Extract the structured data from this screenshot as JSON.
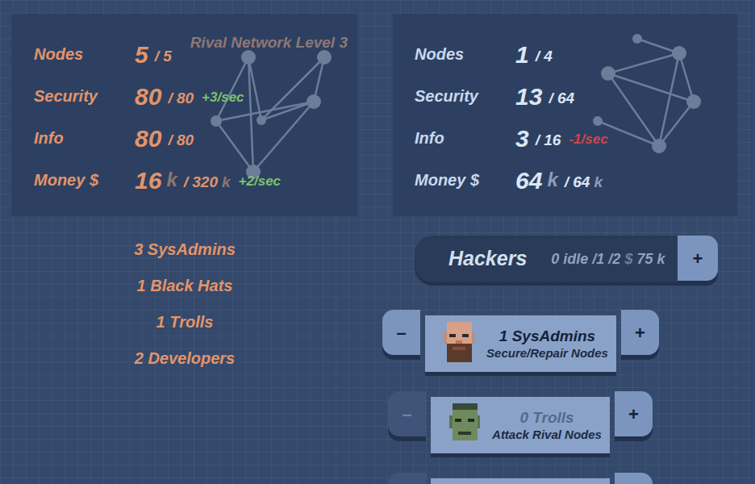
{
  "rival": {
    "title": "Rival Network Level 3",
    "stats": [
      {
        "label": "Nodes",
        "value": "5",
        "value_unit": "",
        "max": "/ 5",
        "max_unit": "",
        "rate": "",
        "color": ""
      },
      {
        "label": "Security",
        "value": "80",
        "value_unit": "",
        "max": "/ 80",
        "max_unit": "",
        "rate": "+3/sec",
        "color": "#7cc26e"
      },
      {
        "label": "Info",
        "value": "80",
        "value_unit": "",
        "max": "/ 80",
        "max_unit": "",
        "rate": "",
        "color": ""
      },
      {
        "label": "Money $",
        "value": "16",
        "value_unit": "k",
        "max": "/ 320",
        "max_unit": "k",
        "rate": "+2/sec",
        "color": "#7cc26e"
      }
    ]
  },
  "player": {
    "stats": [
      {
        "label": "Nodes",
        "value": "1",
        "value_unit": "",
        "max": "/ 4",
        "max_unit": "",
        "rate": "",
        "color": ""
      },
      {
        "label": "Security",
        "value": "13",
        "value_unit": "",
        "max": "/ 64",
        "max_unit": "",
        "rate": "",
        "color": ""
      },
      {
        "label": "Info",
        "value": "3",
        "value_unit": "",
        "max": "/ 16",
        "max_unit": "",
        "rate": "-1/sec",
        "color": "#d0454a"
      },
      {
        "label": "Money $",
        "value": "64",
        "value_unit": "k",
        "max": "/ 64",
        "max_unit": "k",
        "rate": "",
        "color": ""
      }
    ]
  },
  "rival_hackers": [
    "3 SysAdmins",
    "1 Black Hats",
    "1 Trolls",
    "2 Developers"
  ],
  "hackers_bar": {
    "title": "Hackers",
    "summary": "0 idle /1 /2",
    "currency": "$",
    "cost": "75 k",
    "add": "+"
  },
  "hacker_rows": [
    {
      "kind": "sysadmin",
      "minus": "–",
      "plus": "+",
      "label": "1 SysAdmins",
      "description": "Secure/Repair Nodes",
      "disabled": false
    },
    {
      "kind": "troll",
      "minus": "–",
      "plus": "+",
      "label": "0 Trolls",
      "description": "Attack Rival Nodes",
      "disabled": true
    },
    {
      "kind": "cut",
      "minus": "",
      "plus": "",
      "label": "",
      "description": "",
      "disabled": true
    }
  ]
}
